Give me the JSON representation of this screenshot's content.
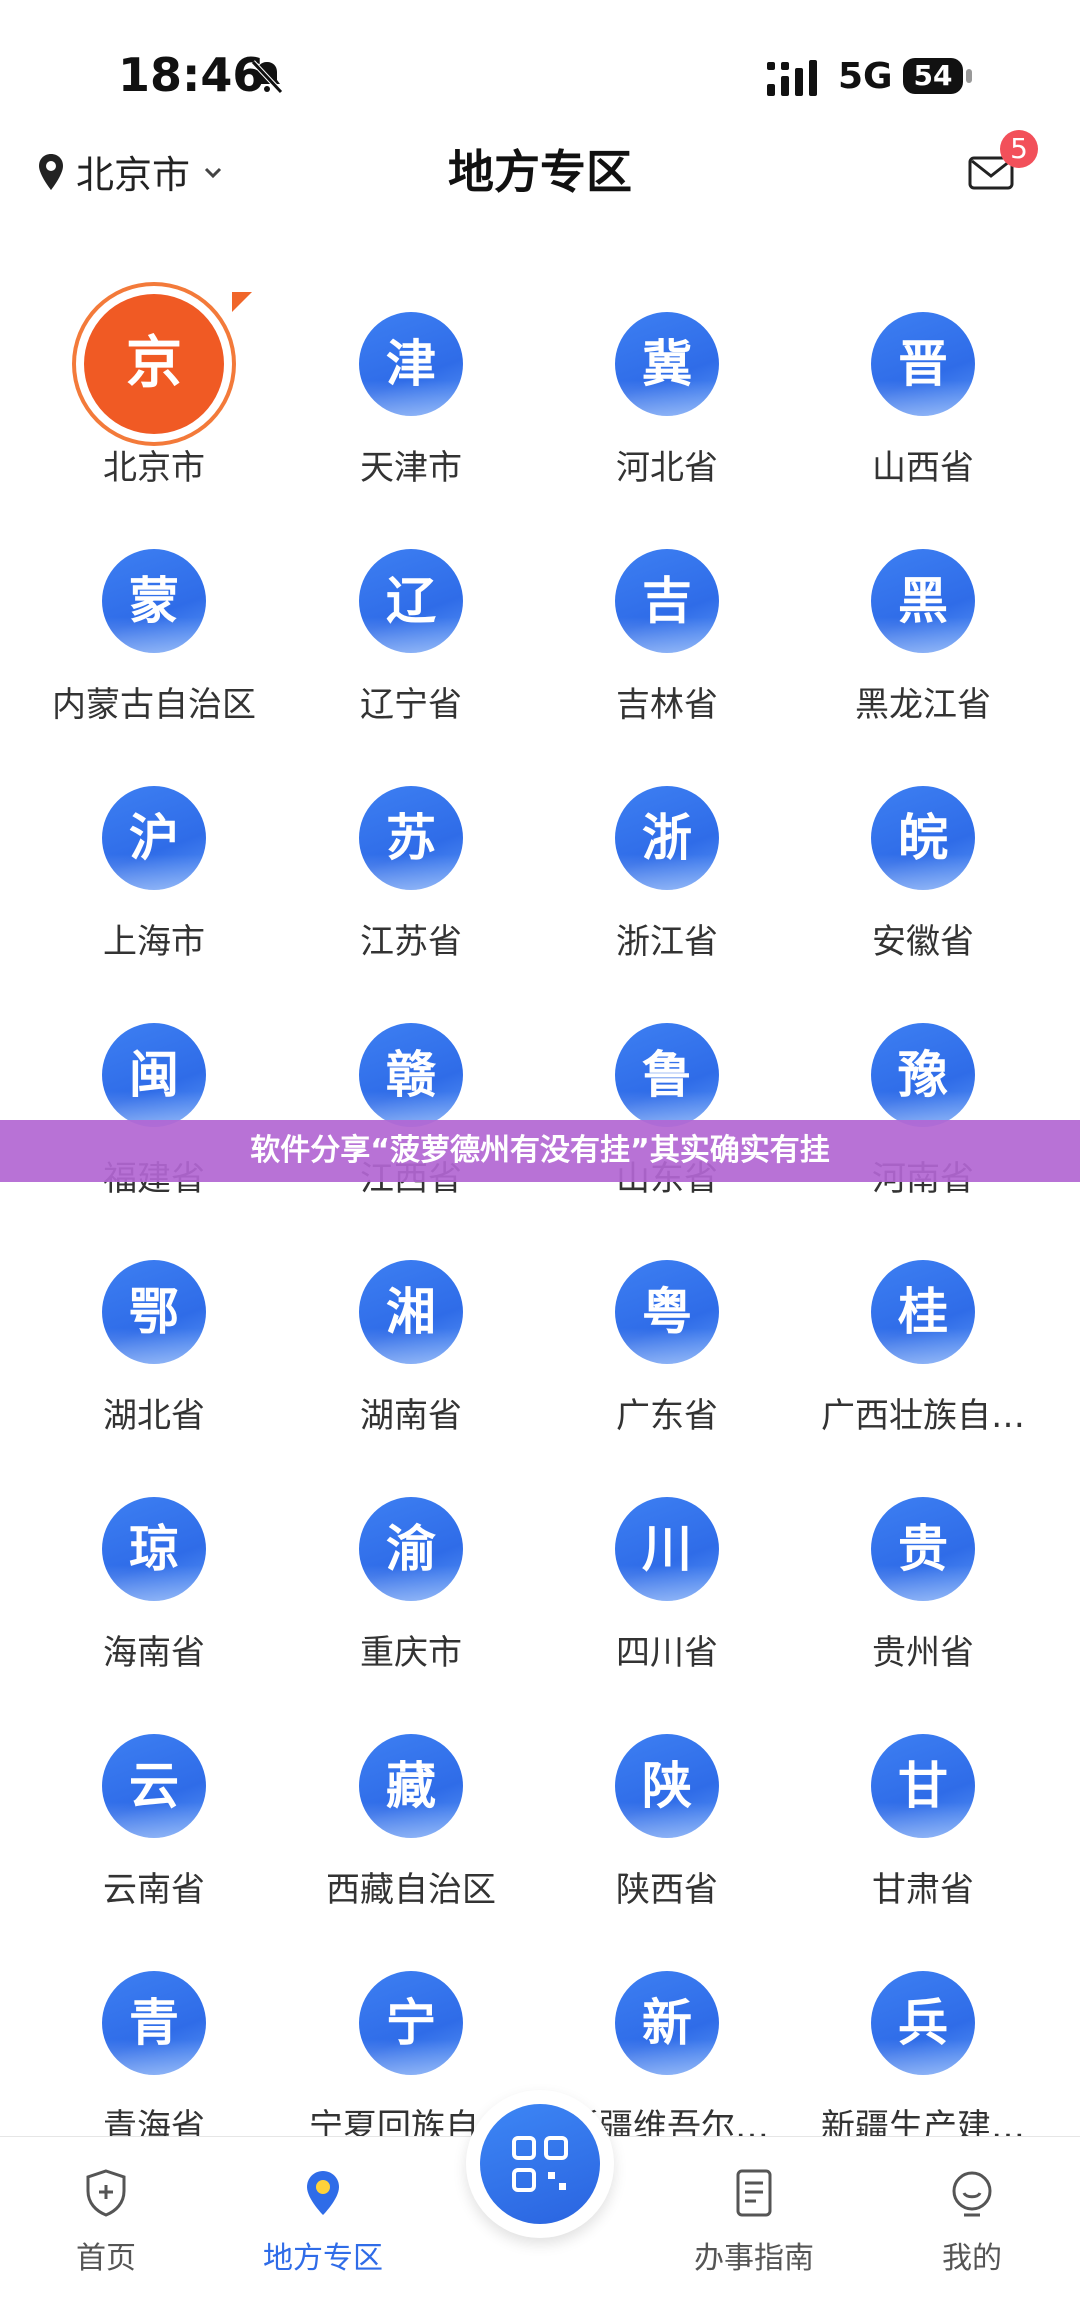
{
  "status_bar": {
    "time": "18:46",
    "network": "5G",
    "battery": "54"
  },
  "header": {
    "location": "北京市",
    "title": "地方专区",
    "mail_badge": "5"
  },
  "regions": [
    {
      "char": "京",
      "name": "北京市"
    },
    {
      "char": "津",
      "name": "天津市"
    },
    {
      "char": "冀",
      "name": "河北省"
    },
    {
      "char": "晋",
      "name": "山西省"
    },
    {
      "char": "蒙",
      "name": "内蒙古自治区"
    },
    {
      "char": "辽",
      "name": "辽宁省"
    },
    {
      "char": "吉",
      "name": "吉林省"
    },
    {
      "char": "黑",
      "name": "黑龙江省"
    },
    {
      "char": "沪",
      "name": "上海市"
    },
    {
      "char": "苏",
      "name": "江苏省"
    },
    {
      "char": "浙",
      "name": "浙江省"
    },
    {
      "char": "皖",
      "name": "安徽省"
    },
    {
      "char": "闽",
      "name": "福建省"
    },
    {
      "char": "赣",
      "name": "江西省"
    },
    {
      "char": "鲁",
      "name": "山东省"
    },
    {
      "char": "豫",
      "name": "河南省"
    },
    {
      "char": "鄂",
      "name": "湖北省"
    },
    {
      "char": "湘",
      "name": "湖南省"
    },
    {
      "char": "粤",
      "name": "广东省"
    },
    {
      "char": "桂",
      "name": "广西壮族自…"
    },
    {
      "char": "琼",
      "name": "海南省"
    },
    {
      "char": "渝",
      "name": "重庆市"
    },
    {
      "char": "川",
      "name": "四川省"
    },
    {
      "char": "贵",
      "name": "贵州省"
    },
    {
      "char": "云",
      "name": "云南省"
    },
    {
      "char": "藏",
      "name": "西藏自治区"
    },
    {
      "char": "陕",
      "name": "陕西省"
    },
    {
      "char": "甘",
      "name": "甘肃省"
    },
    {
      "char": "青",
      "name": "青海省"
    },
    {
      "char": "宁",
      "name": "宁夏回族自…"
    },
    {
      "char": "新",
      "name": "新疆维吾尔…"
    },
    {
      "char": "兵",
      "name": "新疆生产建…"
    }
  ],
  "banner": "软件分享“菠萝德州有没有挂”其实确实有挂",
  "nav": {
    "home": "首页",
    "local": "地方专区",
    "guide": "办事指南",
    "mine": "我的"
  },
  "colors": {
    "accent": "#2f6ce8",
    "active_region": "#f05a24",
    "badge": "#f2505a",
    "banner": "#b266d2"
  }
}
